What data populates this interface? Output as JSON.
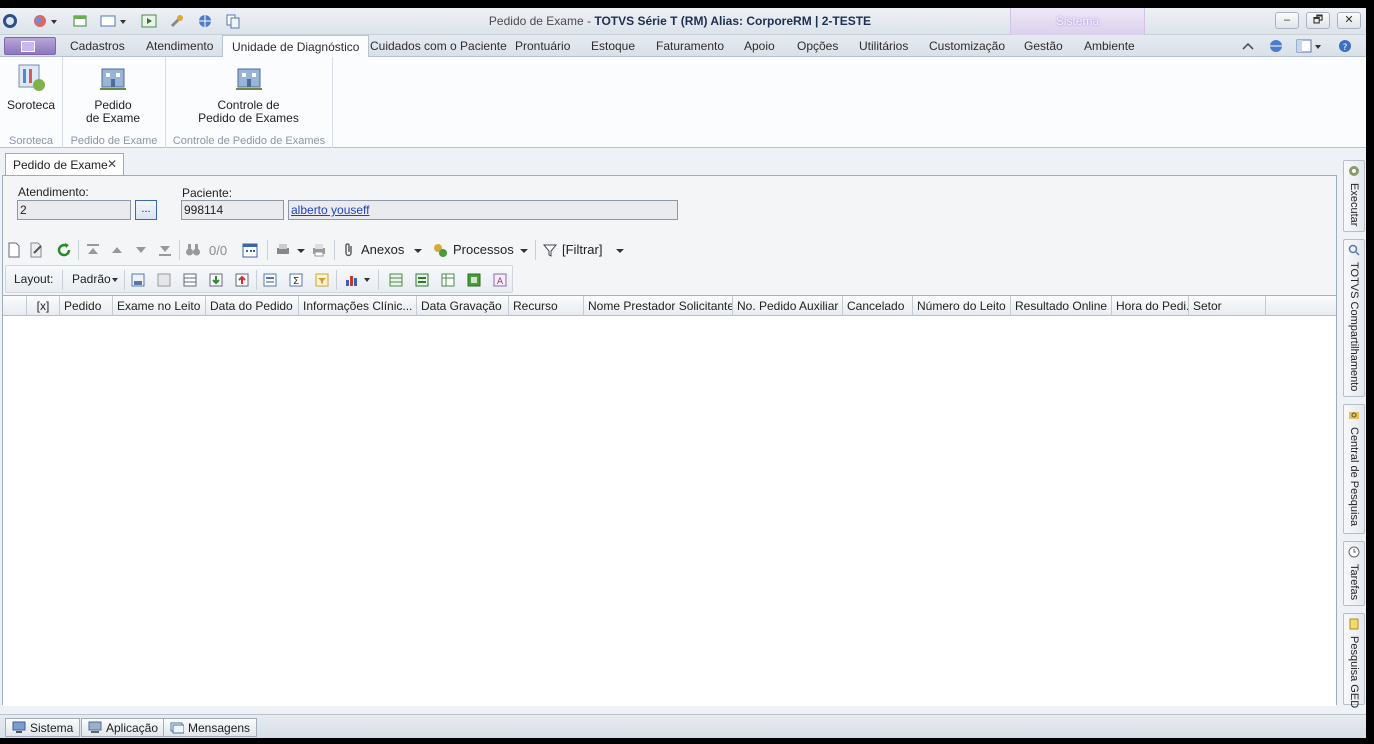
{
  "window": {
    "title_prefix": "Pedido de Exame - ",
    "title_main": "TOTVS Série T  (RM) Alias: CorporeRM | 2-TESTE",
    "context_tab": "Sistema",
    "minimize": "–",
    "restore": "🗗",
    "close": "✕"
  },
  "menu": {
    "items": [
      "Cadastros",
      "Atendimento",
      "Unidade de Diagnóstico",
      "Cuidados com o Paciente",
      "Prontuário",
      "Estoque",
      "Faturamento",
      "Apoio",
      "Opções",
      "Utilitários",
      "Customização",
      "Gestão",
      "Ambiente"
    ],
    "active": "Unidade de Diagnóstico"
  },
  "ribbon": {
    "groups": [
      {
        "label": "Soroteca",
        "buttons": [
          {
            "line1": "Soroteca",
            "line2": ""
          }
        ]
      },
      {
        "label": "Pedido de Exame",
        "buttons": [
          {
            "line1": "Pedido",
            "line2": "de Exame"
          }
        ]
      },
      {
        "label": "Controle de Pedido de Exames",
        "buttons": [
          {
            "line1": "Controle de",
            "line2": "Pedido de Exames"
          }
        ]
      }
    ]
  },
  "doc_tab": {
    "label": "Pedido de Exame",
    "close": "✕"
  },
  "form": {
    "atendimento_label": "Atendimento:",
    "atendimento_value": "2",
    "lookup_label": "...",
    "paciente_label": "Paciente:",
    "paciente_codigo": "998114",
    "paciente_nome": "alberto youseff"
  },
  "toolbar": {
    "counter": "0/0",
    "anexos": "Anexos",
    "processos": "Processos",
    "filtrar": "[Filtrar]"
  },
  "layout_bar": {
    "label": "Layout:",
    "value": "Padrão"
  },
  "grid": {
    "columns": [
      "[x]",
      "Pedido",
      "Exame no Leito",
      "Data do Pedido",
      "Informações Clínic...",
      "Data Gravação",
      "Recurso",
      "Nome Prestador Solicitante",
      "No. Pedido Auxiliar",
      "Cancelado",
      "Número do Leito",
      "Resultado Online",
      "Hora do Pedi...",
      "Setor"
    ],
    "rows": []
  },
  "side_panel": {
    "tabs": [
      "Executar",
      "TOTVS Compartilhamento",
      "Central de Pesquisa",
      "Tarefas",
      "Pesquisa GED"
    ]
  },
  "statusbar": {
    "buttons": [
      "Sistema",
      "Aplicação",
      "Mensagens"
    ]
  }
}
